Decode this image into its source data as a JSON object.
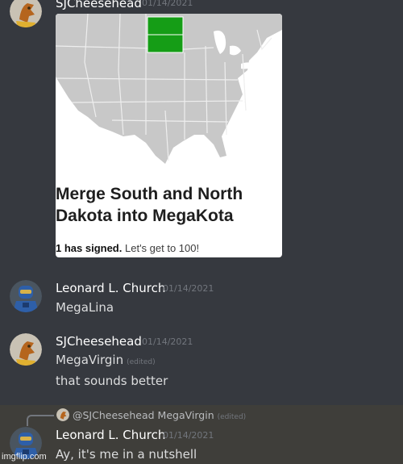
{
  "messages": [
    {
      "username": "SJCheesehead",
      "timestamp": "01/14/2021",
      "avatar": "cheesehead-avatar",
      "embed": {
        "title": "Merge South and North Dakota into MegaKota",
        "signed_count": "1 has signed.",
        "signed_goal": "Let's get to 100!",
        "progress": 0.01,
        "highlight_color": "#159d16"
      }
    },
    {
      "username": "Leonard L. Church",
      "timestamp": "01/14/2021",
      "avatar": "robot-armor-avatar",
      "lines": [
        "MegaLina"
      ]
    },
    {
      "username": "SJCheesehead",
      "timestamp": "01/14/2021",
      "avatar": "cheesehead-avatar",
      "lines": [
        "MegaVirgin",
        "that sounds better"
      ],
      "edited_label": "(edited)"
    },
    {
      "username": "Leonard L. Church",
      "timestamp": "01/14/2021",
      "avatar": "robot-armor-avatar",
      "reply": {
        "mention": "@SJCheesehead",
        "quoted": "MegaVirgin",
        "edited_label": "(edited)"
      },
      "lines": [
        "Ay, it's me in a nutshell"
      ]
    }
  ],
  "watermark": "imgflip.com",
  "colors": {
    "background": "#36393f",
    "username": "#ffffff",
    "timestamp": "#72767d",
    "reply_highlight": "#3f3e3a"
  }
}
